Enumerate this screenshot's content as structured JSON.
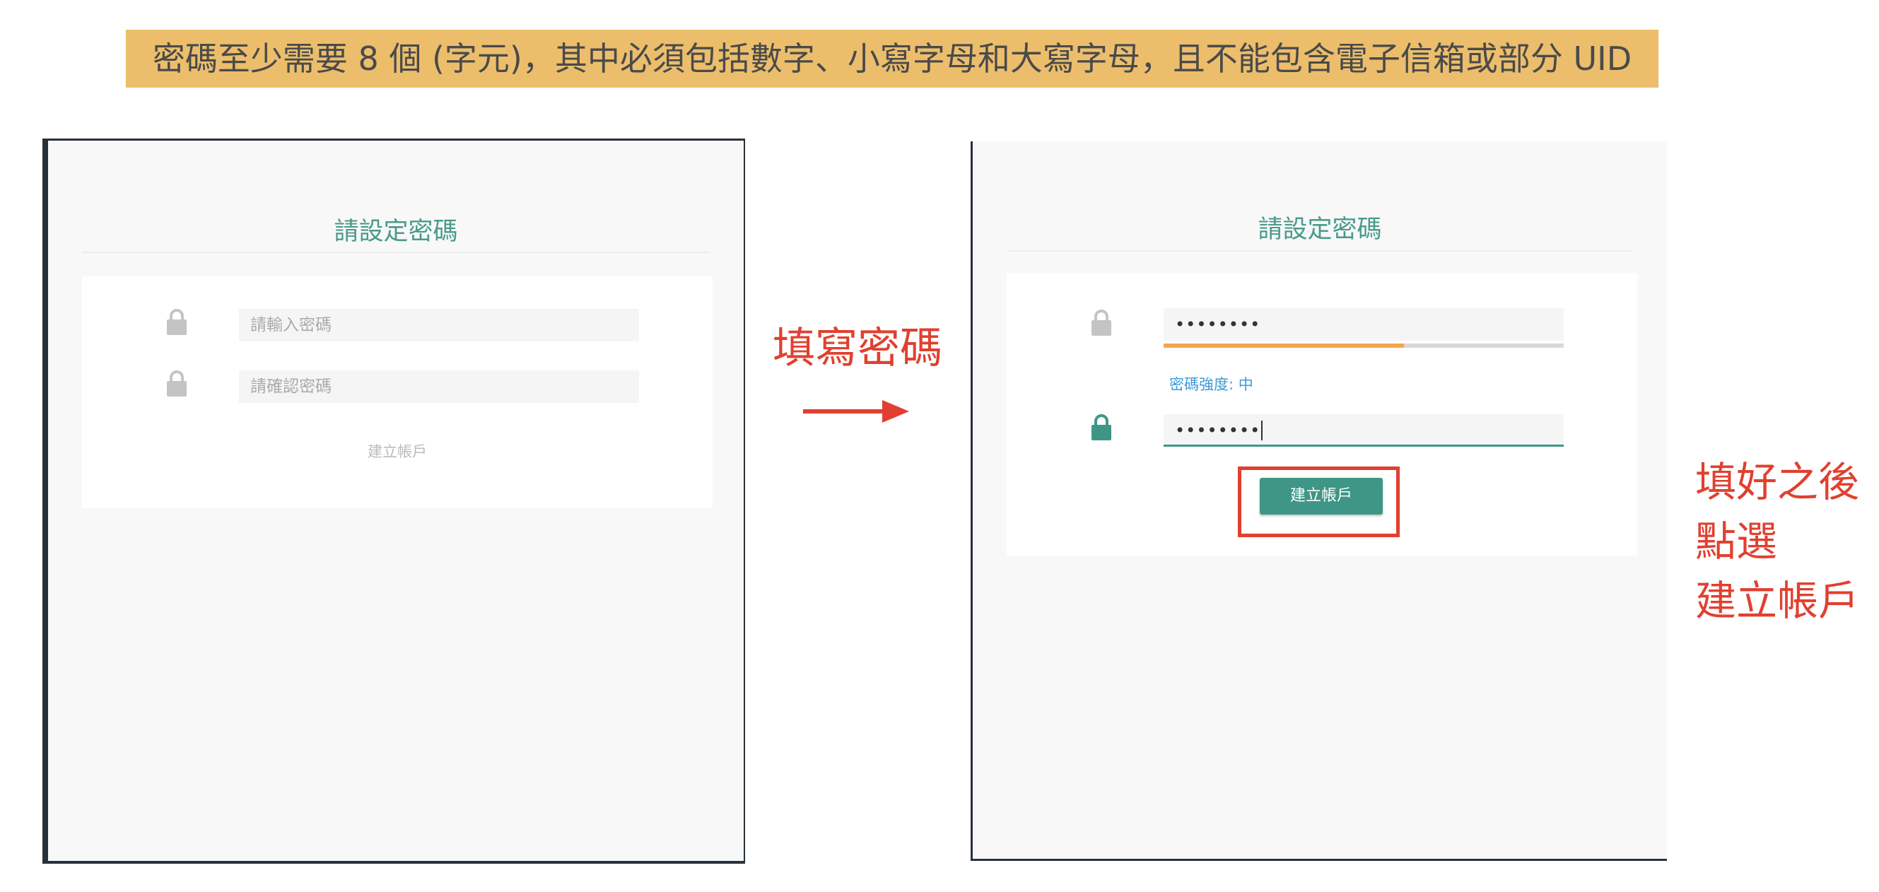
{
  "banner": {
    "text": "密碼至少需要 8 個 (字元)，其中必須包括數字、小寫字母和大寫字母，且不能包含電子信箱或部分 UID"
  },
  "left_panel": {
    "title": "請設定密碼",
    "password_placeholder": "請輸入密碼",
    "confirm_placeholder": "請確認密碼",
    "button_label": "建立帳戶",
    "lock_color": "#c4c4c4"
  },
  "arrow": {
    "label": "填寫密碼",
    "color": "#e04030"
  },
  "right_panel": {
    "title": "請設定密碼",
    "password_value": "••••••••",
    "confirm_value": "••••••••",
    "strength_label": "密碼強度: 中",
    "strength_level": 0.6,
    "button_label": "建立帳戶",
    "lock_inactive_color": "#c4c4c4",
    "lock_active_color": "#3f9686"
  },
  "annotation": {
    "lines": [
      "填好之後",
      "點選",
      "建立帳戶"
    ]
  },
  "colors": {
    "accent": "#3f9686",
    "banner_bg": "#ecbe6c",
    "annotation": "#e04030",
    "strength": "#f3a650"
  }
}
